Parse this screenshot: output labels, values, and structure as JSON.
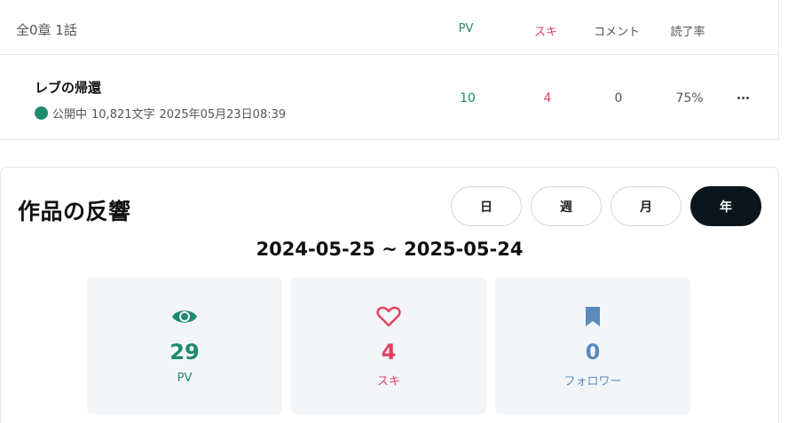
{
  "episode_list": {
    "summary": "全0章 1話",
    "columns": {
      "pv": "PV",
      "suki": "スキ",
      "comment": "コメント",
      "read_rate": "読了率"
    },
    "episodes": [
      {
        "title": "レブの帰還",
        "status": "公開中",
        "char_count": "10,821文字",
        "published_at": "2025年05月23日08:39",
        "pv": "10",
        "suki": "4",
        "comment": "0",
        "read_rate": "75%"
      }
    ]
  },
  "reactions": {
    "title": "作品の反響",
    "ranges": [
      "日",
      "週",
      "月",
      "年"
    ],
    "selected_range": "年",
    "date_range": "2024-05-25 ~ 2025-05-24",
    "stats": [
      {
        "icon": "eye-icon",
        "value": "29",
        "label": "PV",
        "color": "#1f8a6e"
      },
      {
        "icon": "heart-icon",
        "value": "4",
        "label": "スキ",
        "color": "#e2405f"
      },
      {
        "icon": "bookmark-icon",
        "value": "0",
        "label": "フォロワー",
        "color": "#5b8bbd"
      }
    ]
  },
  "colors": {
    "status_published": "#1f8a6e",
    "selected_button": "#0b161c",
    "card_background": "#f3f6f9"
  }
}
